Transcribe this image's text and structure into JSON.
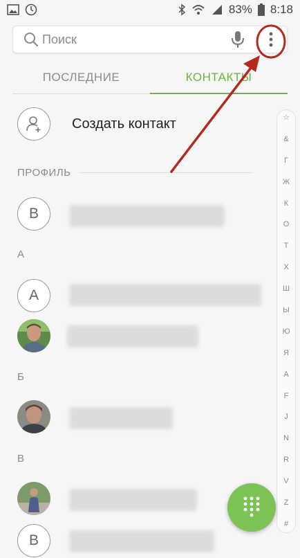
{
  "status_bar": {
    "battery_percent": "83%",
    "time": "8:18",
    "icons": [
      "gallery-icon",
      "clock-icon",
      "bluetooth-icon",
      "wifi-icon",
      "signal-icon",
      "battery-icon"
    ]
  },
  "search": {
    "placeholder": "Поиск",
    "icons": [
      "search-icon",
      "mic-icon",
      "more-vert-icon"
    ]
  },
  "tabs": [
    {
      "label": "ПОСЛЕДНИЕ",
      "active": false
    },
    {
      "label": "КОНТАКТЫ",
      "active": true
    }
  ],
  "create_contact": {
    "label": "Создать контакт",
    "icon": "add-person-icon"
  },
  "sections": {
    "profile": "ПРОФИЛЬ",
    "a": "А",
    "b": "Б",
    "v": "В"
  },
  "contacts": [
    {
      "avatar_letter": "В",
      "name_blurred": true
    },
    {
      "avatar_letter": "А",
      "name_blurred": true
    },
    {
      "avatar_photo": true,
      "name_blurred": true
    },
    {
      "avatar_photo": true,
      "name_blurred": true
    },
    {
      "avatar_photo": true,
      "name_blurred": true
    },
    {
      "avatar_letter": "В",
      "name_blurred": true
    }
  ],
  "index_letters": [
    "☆",
    "&",
    "Г",
    "Ж",
    "К",
    "О",
    "Т",
    "Х",
    "Ш",
    "Ы",
    "Ю",
    "Я",
    "A",
    "F",
    "J",
    "N",
    "R",
    "V",
    "Z",
    "#"
  ],
  "fab": {
    "icon": "dialpad-icon"
  },
  "colors": {
    "accent": "#6db33f",
    "fab": "#7cc254",
    "annotation": "#b22a1e"
  }
}
